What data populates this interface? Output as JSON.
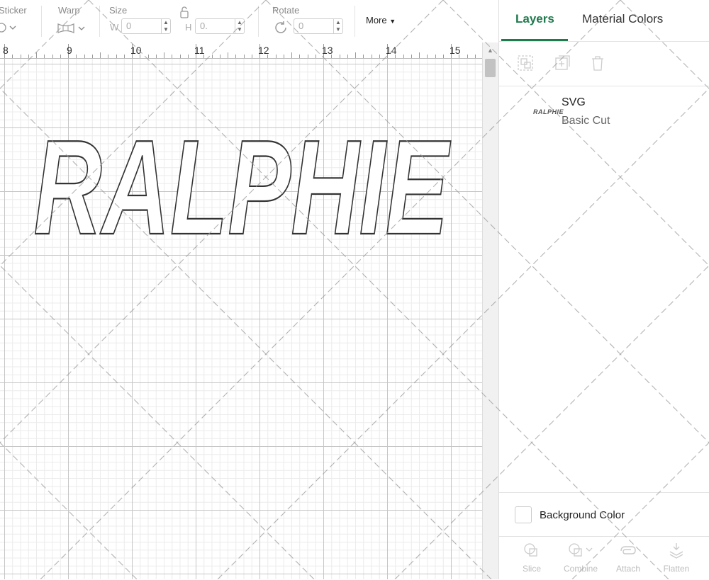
{
  "toolbar": {
    "sticker_label": "Sticker",
    "warp_label": "Warp",
    "size_label": "Size",
    "width_prefix": "W",
    "width_value": "0",
    "height_prefix": "H",
    "height_value": "0.",
    "rotate_label": "Rotate",
    "rotate_value": "0",
    "more_label": "More"
  },
  "ruler": {
    "labels": [
      "8",
      "9",
      "10",
      "11",
      "12",
      "13",
      "14",
      "15"
    ]
  },
  "canvas": {
    "artwork_text": "RALPHIE"
  },
  "panel": {
    "tabs": [
      {
        "label": "Layers",
        "active": true
      },
      {
        "label": "Material Colors",
        "active": false
      }
    ],
    "layer": {
      "thumbnail_text": "RALPHIE",
      "name": "SVG",
      "operation": "Basic Cut"
    },
    "background_color_label": "Background Color",
    "actions": [
      {
        "label": "Slice",
        "icon": "slice-icon"
      },
      {
        "label": "Combine",
        "icon": "combine-icon"
      },
      {
        "label": "Attach",
        "icon": "attach-icon"
      },
      {
        "label": "Flatten",
        "icon": "flatten-icon"
      }
    ]
  },
  "colors": {
    "accent": "#1f7a4d",
    "grid_major": "#c6c6c6",
    "grid_minor": "#ebebeb"
  }
}
